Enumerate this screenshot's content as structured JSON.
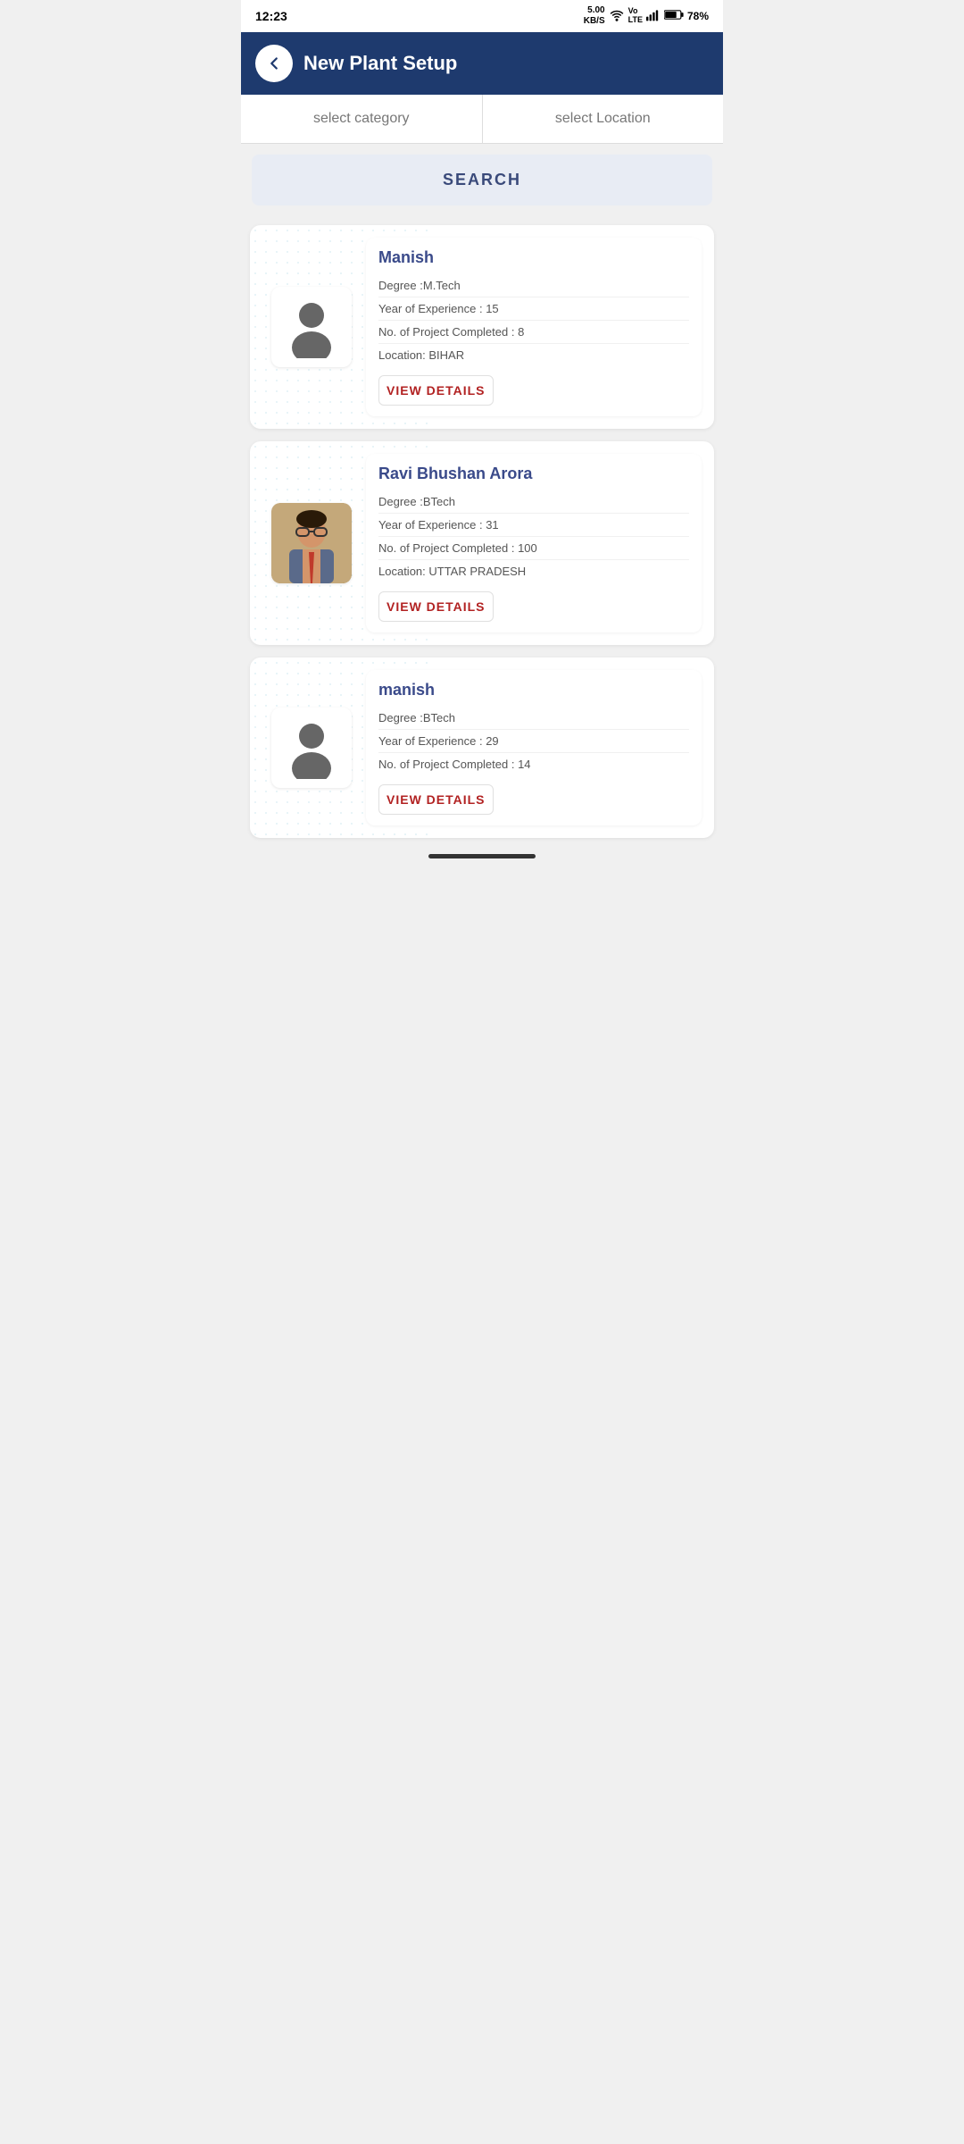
{
  "statusBar": {
    "time": "12:23",
    "dataSpeed": "5.00\nKB/S",
    "battery": "78%",
    "batteryIcon": "battery-icon",
    "wifiIcon": "wifi-icon",
    "signalIcon": "signal-icon",
    "voLteLabel": "Vo\nLTE"
  },
  "header": {
    "title": "New Plant Setup",
    "backLabel": "←"
  },
  "filters": {
    "category": {
      "label": "select category",
      "placeholder": "select category"
    },
    "location": {
      "label": "select Location",
      "placeholder": "select Location"
    }
  },
  "search": {
    "label": "SEARCH"
  },
  "persons": [
    {
      "id": 1,
      "name": "Manish",
      "degree": "Degree :M.Tech",
      "experience": "Year of Experience : 15",
      "projects": "No. of Project Completed : 8",
      "location": "Location: BIHAR",
      "viewDetailsLabel": "VIEW DETAILS",
      "hasPhoto": false
    },
    {
      "id": 2,
      "name": "Ravi Bhushan Arora",
      "degree": "Degree :BTech",
      "experience": "Year of Experience : 31",
      "projects": "No. of Project Completed : 100",
      "location": "Location: UTTAR PRADESH",
      "viewDetailsLabel": "VIEW DETAILS",
      "hasPhoto": true
    },
    {
      "id": 3,
      "name": "manish",
      "degree": "Degree :BTech",
      "experience": "Year of Experience : 29",
      "projects": "No. of Project Completed : 14",
      "location": "",
      "viewDetailsLabel": "VIEW DETAILS",
      "hasPhoto": false
    }
  ]
}
